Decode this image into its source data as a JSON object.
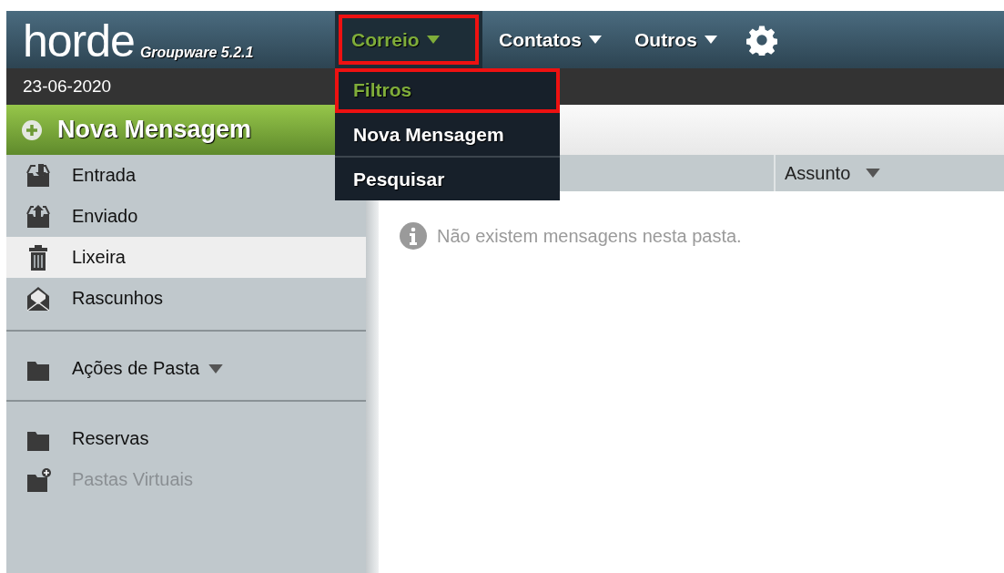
{
  "header": {
    "logo": "horde",
    "product": "Groupware 5.2.1",
    "nav": [
      {
        "kind": "menu",
        "label": "Correio",
        "selected": true,
        "highlighted": true
      },
      {
        "kind": "menu",
        "label": "Contatos",
        "selected": false,
        "highlighted": false
      },
      {
        "kind": "menu",
        "label": "Outros",
        "selected": false,
        "highlighted": false
      },
      {
        "kind": "settings"
      }
    ]
  },
  "date": "23-06-2020",
  "compose_button": "Nova Mensagem",
  "sidebar": {
    "sections": [
      {
        "items": [
          {
            "kind": "inbox",
            "label": "Entrada",
            "selected": false,
            "disabled": false
          },
          {
            "kind": "sent",
            "label": "Enviado",
            "selected": false,
            "disabled": false
          },
          {
            "kind": "trash",
            "label": "Lixeira",
            "selected": true,
            "disabled": false
          },
          {
            "kind": "drafts",
            "label": "Rascunhos",
            "selected": false,
            "disabled": false
          }
        ]
      },
      {
        "items": [
          {
            "kind": "actions",
            "label": "Ações de Pasta",
            "selected": false,
            "disabled": false
          }
        ]
      },
      {
        "items": [
          {
            "kind": "folder",
            "label": "Reservas",
            "selected": false,
            "disabled": false
          },
          {
            "kind": "virtual",
            "label": "Pastas Virtuais",
            "selected": false,
            "disabled": true
          }
        ]
      }
    ]
  },
  "dropdown": {
    "items": [
      {
        "label": "Filtros",
        "selected": true,
        "highlighted": true
      },
      {
        "label": "Nova Mensagem",
        "selected": false,
        "highlighted": false
      },
      {
        "label": "Pesquisar",
        "selected": false,
        "highlighted": false
      }
    ]
  },
  "message_list": {
    "columns": [
      {
        "label": "Assunto"
      }
    ],
    "empty_message": "Não existem mensagens nesta pasta."
  }
}
